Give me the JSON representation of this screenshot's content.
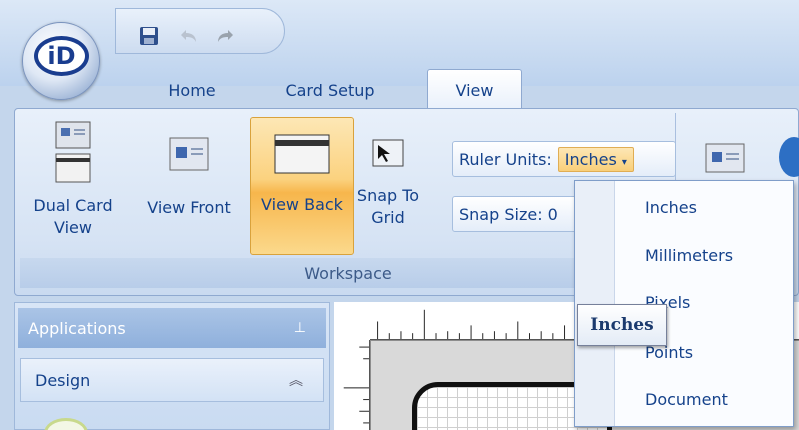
{
  "app": {
    "logo_text": "iD"
  },
  "quick_access": {
    "icons": [
      "save-icon",
      "undo-icon",
      "redo-icon"
    ]
  },
  "tabs": [
    {
      "label": "Home"
    },
    {
      "label": "Card Setup"
    },
    {
      "label": "View",
      "selected": true
    }
  ],
  "ribbon": {
    "group_label": "Workspace",
    "buttons": [
      {
        "label_line1": "Dual Card",
        "label_line2": "View",
        "icon": "dual-card-icon"
      },
      {
        "label_line1": "View Front",
        "label_line2": "",
        "icon": "card-front-icon"
      },
      {
        "label_line1": "View Back",
        "label_line2": "",
        "icon": "card-back-icon",
        "active": true
      },
      {
        "label_line1": "Snap To",
        "label_line2": "Grid",
        "icon": "snap-grid-icon"
      }
    ],
    "ruler_units_label": "Ruler Units:",
    "ruler_units_value": "Inches",
    "snap_size_label": "Snap Size: 0"
  },
  "left_panel": {
    "applications_label": "Applications",
    "design_label": "Design"
  },
  "dropdown": {
    "items": [
      "Inches",
      "Millimeters",
      "Pixels",
      "Points",
      "Document"
    ],
    "visible_fragments": [
      "Inches",
      "Millimeters",
      "P",
      "els",
      "Points",
      "Document"
    ]
  },
  "tooltip": {
    "text": "Inches"
  },
  "colors": {
    "accent": "#f9cf79",
    "text": "#15428b",
    "ribbon": "#d6e3f4"
  }
}
